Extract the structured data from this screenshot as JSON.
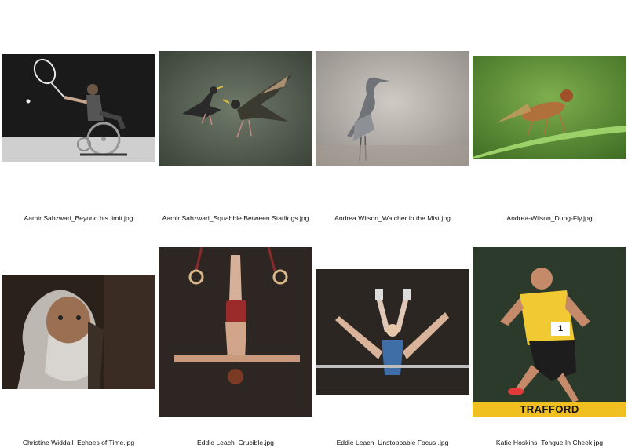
{
  "photos": [
    {
      "caption": "Aamir Sabzwari_Beyond his limit.jpg",
      "subject": "wheelchair-tennis-player"
    },
    {
      "caption": "Aamir Sabzwari_Squabble Between Starlings.jpg",
      "subject": "starlings"
    },
    {
      "caption": "Andrea Wilson_Watcher in the Mist.jpg",
      "subject": "heron"
    },
    {
      "caption": "Andrea-Wilson_Dung-Fly.jpg",
      "subject": "dung-fly"
    },
    {
      "caption": "Christine Widdall_Echoes of Time.jpg",
      "subject": "bearded-man-portrait"
    },
    {
      "caption": "Eddie Leach_Crucible.jpg",
      "subject": "gymnast-on-rings"
    },
    {
      "caption": "Eddie Leach_Unstoppable Focus .jpg",
      "subject": "gymnast-on-bar"
    },
    {
      "caption": "Katie Hoskins_Tongue In Cheek.jpg",
      "subject": "runner"
    }
  ],
  "runner_banner_text": "TRAFFORD",
  "runner_bib_number": "1"
}
